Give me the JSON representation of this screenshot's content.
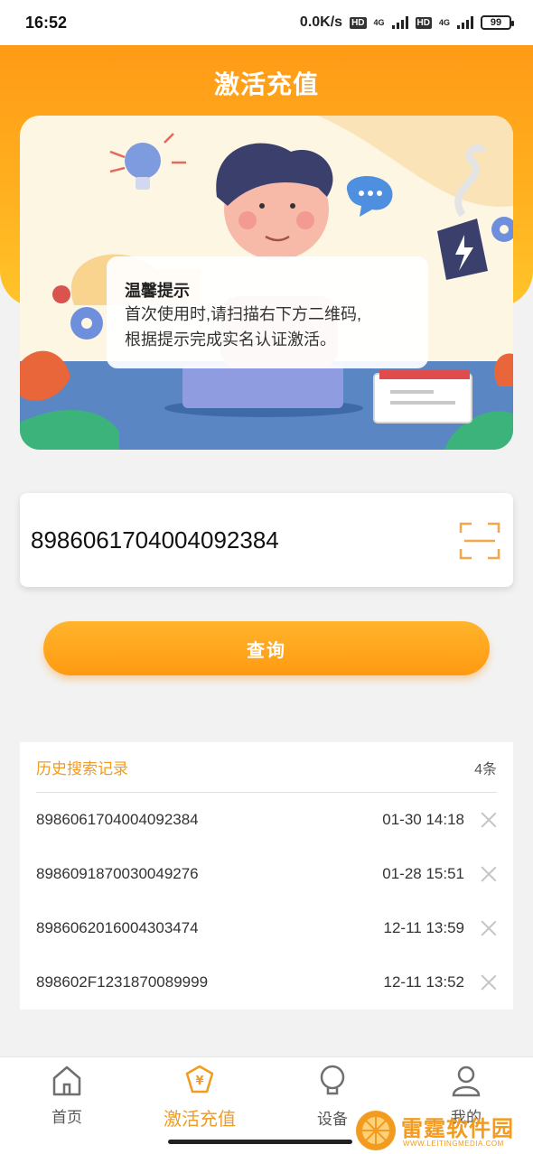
{
  "status_bar": {
    "time": "16:52",
    "speed": "0.0K/s",
    "hd_label": "HD",
    "network": "4G",
    "battery": "99"
  },
  "header": {
    "title": "激活充值"
  },
  "tip": {
    "title": "温馨提示",
    "line1": "首次使用时,请扫描右下方二维码,",
    "line2": "根据提示完成实名认证激活。"
  },
  "search": {
    "value": "89860617040040923​84",
    "placeholder": ""
  },
  "query_button": {
    "label": "查询"
  },
  "history": {
    "title": "历史搜索记录",
    "count": "4条",
    "rows": [
      {
        "number": "89860617040040923​84",
        "time": "01-30 14:18"
      },
      {
        "number": "8986091870030049276",
        "time": "01-28 15:51"
      },
      {
        "number": "8986062016004303474",
        "time": "12-11 13:59"
      },
      {
        "number": "898602F1231870089999",
        "time": "12-11 13:52"
      }
    ]
  },
  "nav": {
    "items": [
      {
        "label": "首页",
        "icon": "home-icon"
      },
      {
        "label": "激活充值",
        "icon": "yen-tag-icon"
      },
      {
        "label": "设备",
        "icon": "bulb-icon"
      },
      {
        "label": "我的",
        "icon": "user-icon"
      }
    ]
  },
  "watermark": {
    "name": "雷霆软件园",
    "url": "WWW.LEITINGMEDIA.COM"
  },
  "colors": {
    "accent": "#f29b1f",
    "header_top": "#ff9a16",
    "header_bottom": "#ffc42a"
  }
}
